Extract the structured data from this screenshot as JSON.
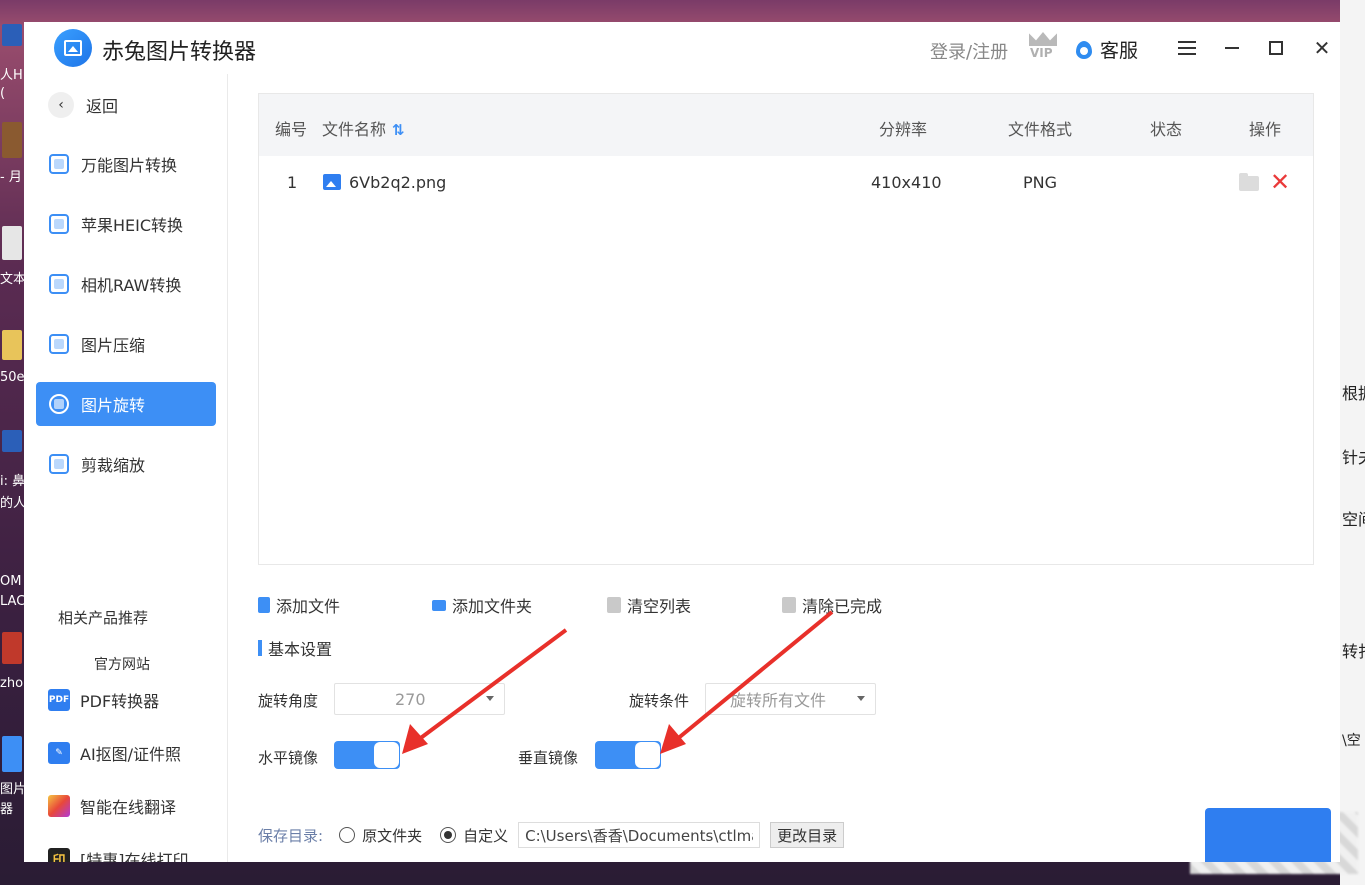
{
  "app": {
    "title": "赤兔图片转换器",
    "login": "登录/注册",
    "vip": "VIP",
    "service": "客服"
  },
  "sidebar": {
    "back": "返回",
    "items": [
      {
        "label": "万能图片转换",
        "icon": "image-convert-icon"
      },
      {
        "label": "苹果HEIC转换",
        "icon": "heic-icon"
      },
      {
        "label": "相机RAW转换",
        "icon": "raw-icon"
      },
      {
        "label": "图片压缩",
        "icon": "compress-icon"
      },
      {
        "label": "图片旋转",
        "icon": "rotate-icon",
        "active": true
      },
      {
        "label": "剪裁缩放",
        "icon": "crop-icon"
      }
    ],
    "related_title": "相关产品推荐",
    "official_site": "官方网站",
    "products": [
      {
        "label": "PDF转换器",
        "icon_text": "PDF",
        "color": "#2f7ef0"
      },
      {
        "label": "AI抠图/证件照",
        "icon_text": "",
        "color": "#2f7ef0"
      },
      {
        "label": "智能在线翻译",
        "icon_text": "",
        "color": "#f08a2f"
      },
      {
        "label": "[特惠]在线打印",
        "icon_text": "印",
        "color": "#222222"
      }
    ]
  },
  "table": {
    "headers": {
      "index": "编号",
      "name": "文件名称",
      "resolution": "分辨率",
      "format": "文件格式",
      "status": "状态",
      "ops": "操作"
    },
    "rows": [
      {
        "index": "1",
        "name": "6Vb2q2.png",
        "resolution": "410x410",
        "format": "PNG",
        "status": ""
      }
    ]
  },
  "actions": {
    "add_file": "添加文件",
    "add_folder": "添加文件夹",
    "clear_list": "清空列表",
    "clear_done": "清除已完成"
  },
  "settings": {
    "section_title": "基本设置",
    "rotate_angle_label": "旋转角度",
    "rotate_angle_value": "270",
    "rotate_condition_label": "旋转条件",
    "rotate_condition_value": "旋转所有文件",
    "h_mirror_label": "水平镜像",
    "h_mirror_on": true,
    "v_mirror_label": "垂直镜像",
    "v_mirror_on": true
  },
  "save": {
    "label": "保存目录:",
    "option_original": "原文件夹",
    "option_custom": "自定义",
    "selected": "custom",
    "path": "C:\\Users\\香香\\Documents\\ctlma",
    "change_button": "更改目录"
  },
  "colors": {
    "accent": "#3d8ff5",
    "delete": "#ea3a3a",
    "annotation_arrow": "#e8302a"
  },
  "desktop": {
    "left_fragments": [
      "人H",
      "(",
      "- 月",
      "文本",
      "50e",
      "i: 鼻",
      "的人",
      "OM",
      "LAC",
      "zho",
      "图片",
      "器"
    ],
    "right_fragments": [
      "根据",
      "针夫",
      "空间",
      "转扎",
      "\\空"
    ]
  }
}
